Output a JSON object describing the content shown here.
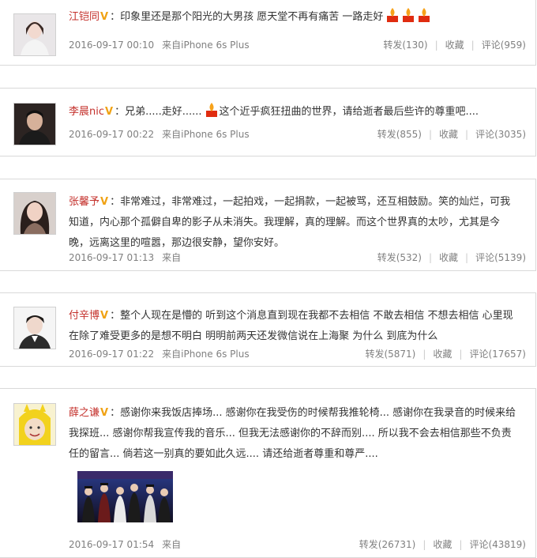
{
  "posts": [
    {
      "name": "江铠同",
      "vbadge": "V",
      "text": "：印象里还是那个阳光的大男孩  愿天堂不再有痛苦  一路走好",
      "time": "2016-09-17 00:10",
      "source": "来自iPhone 6s Plus",
      "repost": "转发(130)",
      "fav": "收藏",
      "comment": "评论(959)",
      "sep": "|"
    },
    {
      "name": "李晨nic",
      "vbadge": "V",
      "text_a": "：兄弟.....走好......",
      "text_b": "这个近乎疯狂扭曲的世界，请给逝者最后些许的尊重吧....",
      "time": "2016-09-17 00:22",
      "source": "来自iPhone 6s Plus",
      "repost": "转发(855)",
      "fav": "收藏",
      "comment": "评论(3035)",
      "sep": "|"
    },
    {
      "name": "张馨予",
      "vbadge": "V",
      "text": "：非常难过，非常难过，一起拍戏，一起捐款，一起被骂，还互相鼓励。笑的灿烂，可我知道，内心那个孤僻自卑的影子从未消失。我理解，真的理解。而这个世界真的太吵，尤其是今晚，远离这里的喧嚣，那边很安静，望你安好。",
      "time": "2016-09-17 01:13",
      "source": "来自",
      "repost": "转发(532)",
      "fav": "收藏",
      "comment": "评论(5139)",
      "sep": "|"
    },
    {
      "name": "付辛博",
      "vbadge": "V",
      "text": "：整个人现在是懵的 听到这个消息直到现在我都不去相信 不敢去相信 不想去相信 心里现在除了难受更多的是想不明白 明明前两天还发微信说在上海聚 为什么 到底为什么",
      "time": "2016-09-17 01:22",
      "source": "来自iPhone 6s Plus",
      "repost": "转发(5871)",
      "fav": "收藏",
      "comment": "评论(17657)",
      "sep": "|"
    },
    {
      "name": "薛之谦",
      "vbadge": "V",
      "text": "：感谢你来我饭店捧场... 感谢你在我受伤的时候帮我推轮椅... 感谢你在我录音的时候来给我探班... 感谢你帮我宣传我的音乐... 但我无法感谢你的不辞而别.... 所以我不会去相信那些不负责任的留言... 倘若这一别真的要如此久远.... 请还给逝者尊重和尊严....",
      "time": "2016-09-17 01:54",
      "source": "来自",
      "repost": "转发(26731)",
      "fav": "收藏",
      "comment": "评论(43819)",
      "sep": "|"
    }
  ],
  "colors": {
    "name": "#c4302b",
    "vbadge": "#f0a214",
    "meta": "#808080",
    "border": "#d9d9d9"
  },
  "icons": {
    "candle": "candle-icon",
    "vbadge": "verified-badge-icon"
  }
}
